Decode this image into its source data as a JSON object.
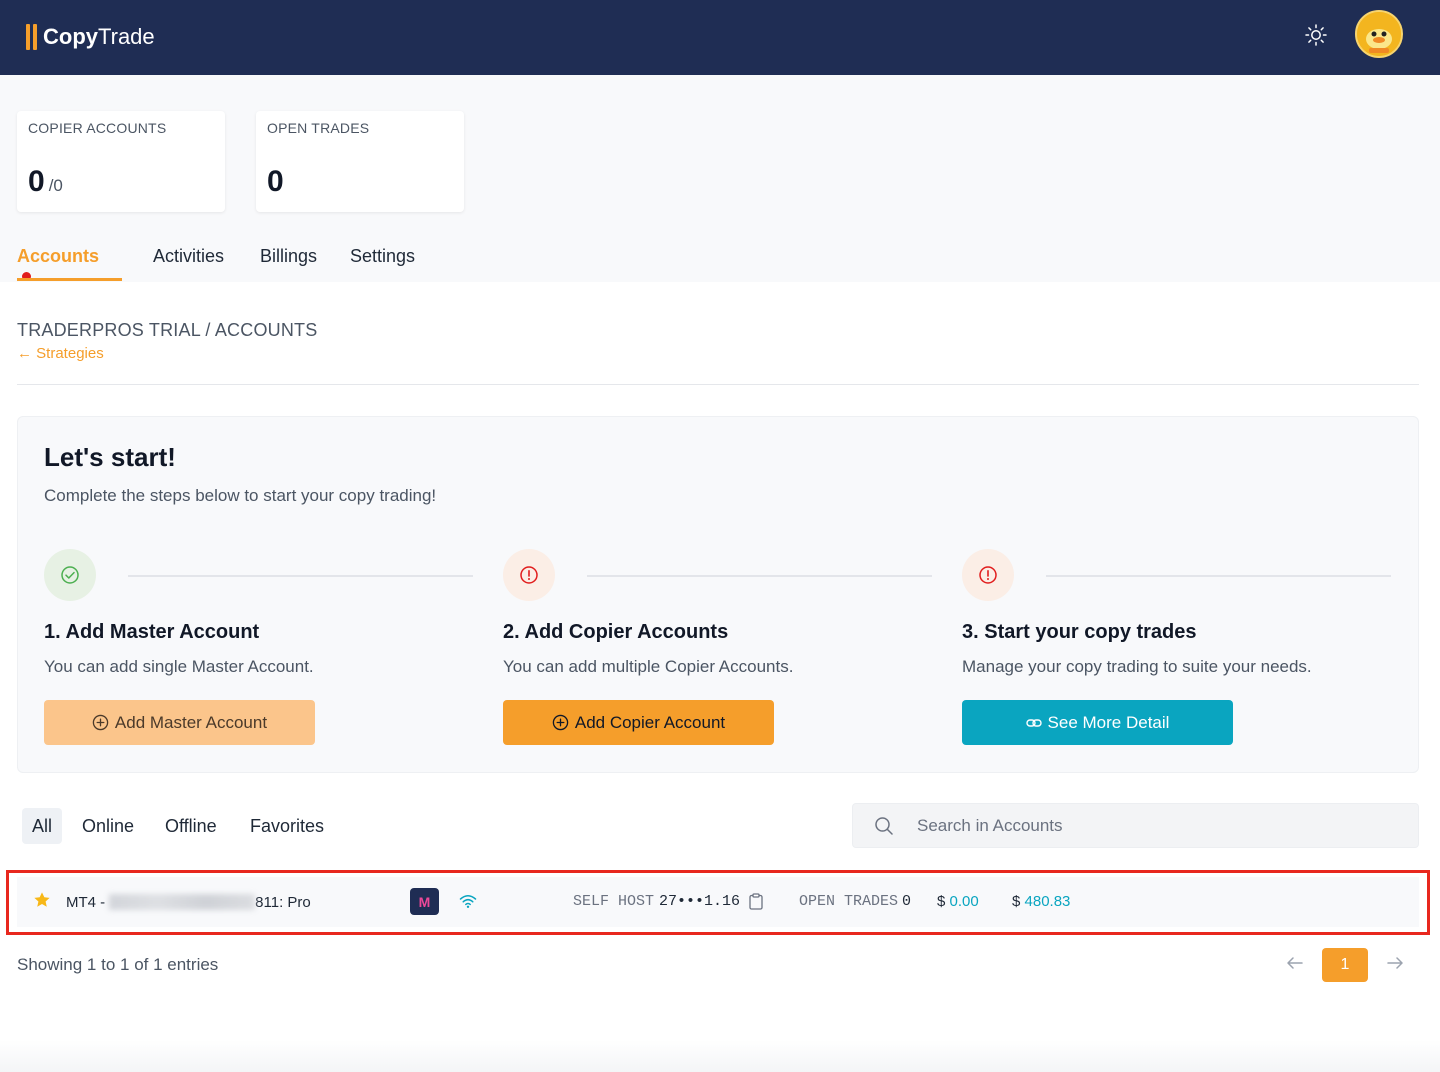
{
  "header": {
    "logo_bold": "Copy",
    "logo_light": "Trade",
    "theme_icon": "sun-icon",
    "avatar_icon": "avatar-duck"
  },
  "stats": [
    {
      "label": "COPIER ACCOUNTS",
      "value": "0",
      "sub": "/0"
    },
    {
      "label": "OPEN TRADES",
      "value": "0",
      "sub": ""
    }
  ],
  "tabs": [
    {
      "label": "Accounts",
      "active": true,
      "has_dot": true
    },
    {
      "label": "Activities",
      "active": false
    },
    {
      "label": "Billings",
      "active": false
    },
    {
      "label": "Settings",
      "active": false
    }
  ],
  "breadcrumb": "TRADERPROS TRIAL / ACCOUNTS",
  "back_link": {
    "arrow": "←",
    "label": "Strategies"
  },
  "start": {
    "title": "Let's start!",
    "subtitle": "Complete the steps below to start your copy trading!",
    "steps": [
      {
        "status": "done",
        "icon": "check-circle-icon",
        "title": "1. Add Master Account",
        "desc": "You can add single Master Account.",
        "button": "Add Master Account",
        "button_icon": "plus-circle-icon"
      },
      {
        "status": "pending",
        "icon": "alert-circle-icon",
        "title": "2. Add Copier Accounts",
        "desc": "You can add multiple Copier Accounts.",
        "button": "Add Copier Account",
        "button_icon": "plus-circle-icon"
      },
      {
        "status": "pending",
        "icon": "alert-circle-icon",
        "title": "3. Start your copy trades",
        "desc": "Manage your copy trading to suite your needs.",
        "button": "See More Detail",
        "button_icon": "link-icon"
      }
    ]
  },
  "filters": [
    {
      "label": "All",
      "active": true
    },
    {
      "label": "Online",
      "active": false
    },
    {
      "label": "Offline",
      "active": false
    },
    {
      "label": "Favorites",
      "active": false
    }
  ],
  "search": {
    "placeholder": "Search in Accounts",
    "value": ""
  },
  "accounts": [
    {
      "favorite": true,
      "platform_prefix": "MT4 -",
      "name_suffix": "811: Pro",
      "badge": "M",
      "connection": "wifi-icon",
      "host_label": "SELF HOST",
      "ip": "27•••1.16",
      "open_trades_label": "OPEN TRADES",
      "open_trades": "0",
      "currency": "$",
      "pnl": "0.00",
      "balance": "480.83"
    }
  ],
  "pagination": {
    "showing": "Showing 1 to 1 of 1 entries",
    "prev": "←",
    "current": "1",
    "next": "→"
  },
  "colors": {
    "navy": "#1f2d54",
    "orange": "#f59e2b",
    "orange_light": "#fbc58b",
    "teal": "#0aa5c0",
    "red": "#e11d1d",
    "green": "#4caf50"
  }
}
